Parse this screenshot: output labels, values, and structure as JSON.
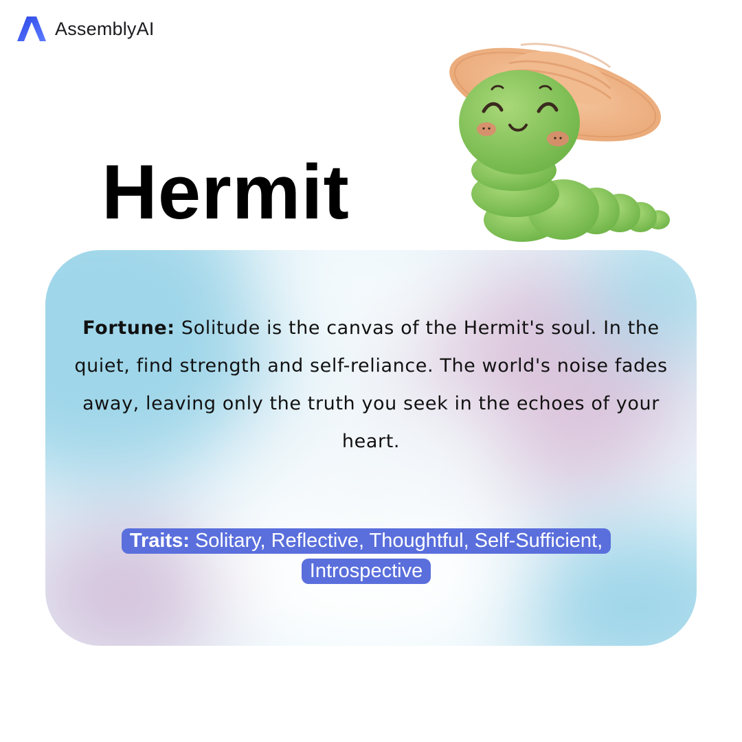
{
  "brand": {
    "name": "AssemblyAI",
    "logo_icon": "assemblyai-logo-icon"
  },
  "title": "Hermit",
  "mascot": {
    "icon": "caterpillar-straw-hat-illustration"
  },
  "card": {
    "fortune_label": "Fortune:",
    "fortune_text": " Solitude is the canvas of the Hermit's soul. In the quiet, find strength and self-reliance. The world's noise fades away, leaving only the truth you seek in the echoes of your heart.",
    "traits_label": "Traits:",
    "traits_text": " Solitary, Reflective, Thoughtful, Self-Sufficient, Introspective"
  },
  "colors": {
    "traits_badge": "#5a6fdc",
    "logo_blue": "#3a5bef",
    "card_blue": "#9fd6e9",
    "card_pink": "#dcc4dc"
  }
}
